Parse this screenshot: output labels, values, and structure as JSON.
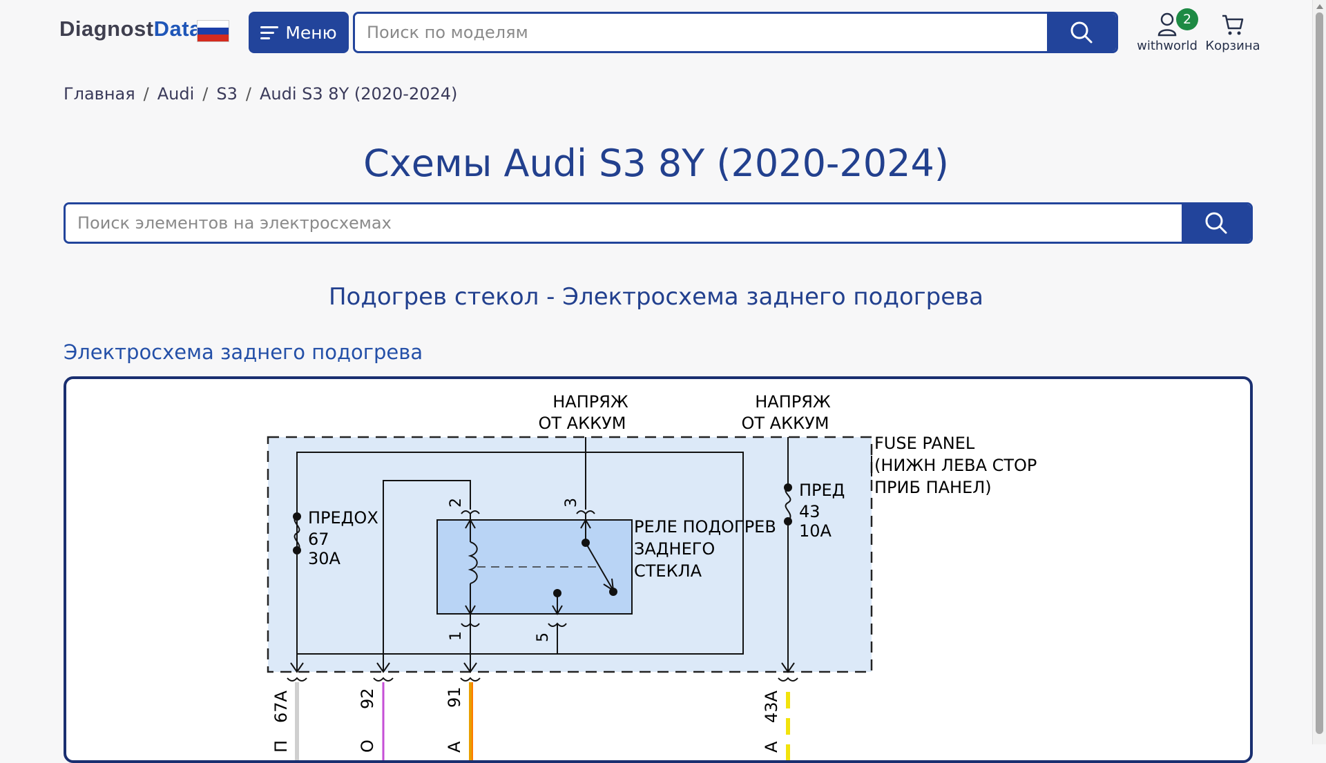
{
  "header": {
    "logo_part1": "Diagnost",
    "logo_part2": "Data",
    "flag_colors": [
      "#ffffff",
      "#1c3fa8",
      "#d52b1e"
    ],
    "menu_label": "Меню",
    "search_placeholder": "Поиск по моделям",
    "user_label": "withworld",
    "user_badge": "2",
    "cart_label": "Корзина"
  },
  "breadcrumb": [
    {
      "label": "Главная"
    },
    {
      "label": "Audi"
    },
    {
      "label": "S3"
    },
    {
      "label": "Audi S3 8Y (2020-2024)"
    }
  ],
  "breadcrumb_separator": "/",
  "page_title": "Схемы Audi S3 8Y (2020-2024)",
  "element_search_placeholder": "Поиск элементов на электросхемах",
  "section_title": "Подогрев стекол - Электросхема заднего подогрева",
  "diagram_heading": "Электросхема заднего подогрева",
  "colors": {
    "primary": "#22449b",
    "badge": "#1e8a44",
    "diagram_fill": "#dce9f8",
    "relay_fill": "#b9d4f5"
  },
  "diagram": {
    "voltage_label_1a": "НАПРЯЖ",
    "voltage_label_1b": "ОТ АККУМ",
    "voltage_label_2a": "НАПРЯЖ",
    "voltage_label_2b": "ОТ АККУМ",
    "fuse_panel_1": "FUSE PANEL",
    "fuse_panel_2": "(НИЖН ЛЕВА СТОР",
    "fuse_panel_3": "ПРИБ ПАНЕЛ)",
    "fuse1_a": "ПРЕДОХ",
    "fuse1_b": "67",
    "fuse1_c": "30A",
    "fuse2_a": "ПРЕД",
    "fuse2_b": "43",
    "fuse2_c": "10A",
    "relay_a": "РЕЛЕ ПОДОГРЕВ",
    "relay_b": "ЗАДНЕГО",
    "relay_c": "СТЕКЛА",
    "pin_2": "2",
    "pin_3": "3",
    "pin_1": "1",
    "pin_5": "5",
    "wire_67a": "67A",
    "wire_92": "92",
    "wire_91": "91",
    "wire_43a": "43A",
    "wire_partial_1": "П",
    "wire_partial_2": "О",
    "wire_partial_3": "А",
    "wire_partial_4": "А"
  }
}
